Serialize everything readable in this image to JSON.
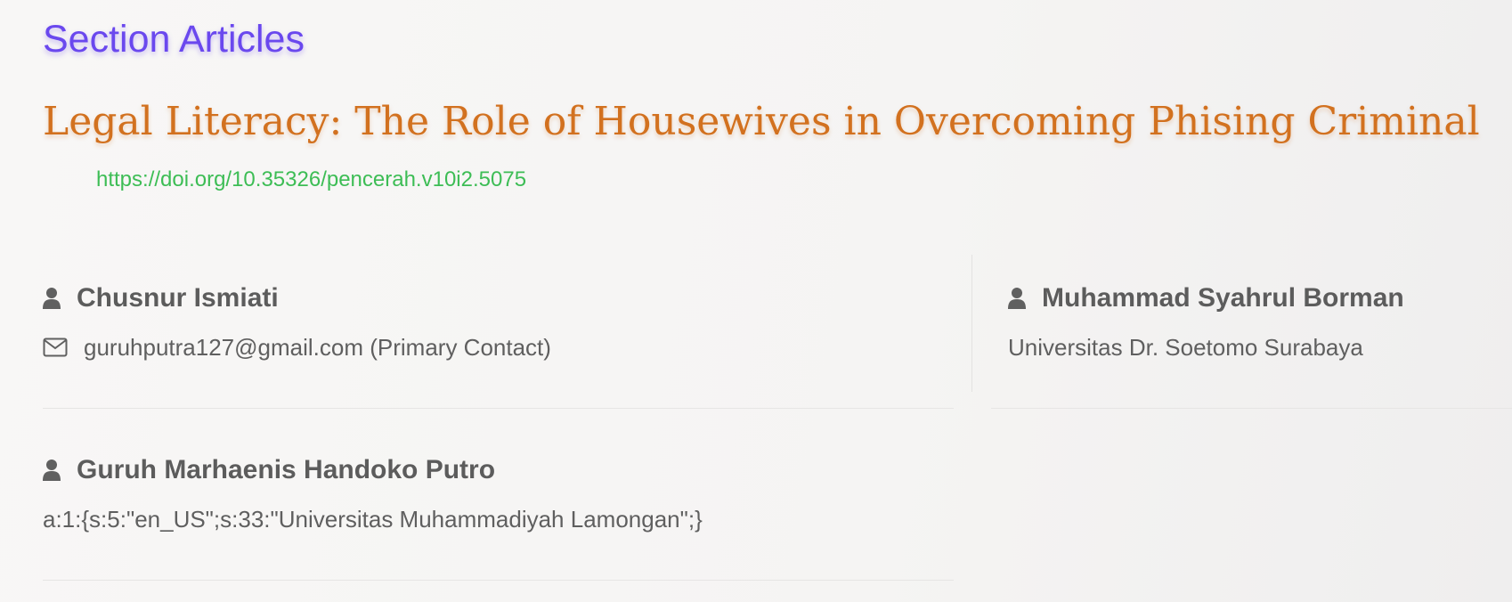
{
  "section": {
    "title": "Section Articles"
  },
  "article": {
    "title": "Legal Literacy: The Role of Housewives in Overcoming Phising Criminal",
    "doi": "https://doi.org/10.35326/pencerah.v10i2.5075"
  },
  "authors": [
    {
      "name": "Chusnur Ismiati",
      "detail": "guruhputra127@gmail.com (Primary Contact)",
      "detail_icon": "envelope-icon"
    },
    {
      "name": "Muhammad Syahrul Borman",
      "detail": "Universitas Dr. Soetomo Surabaya"
    },
    {
      "name": "Guruh Marhaenis Handoko Putro",
      "detail": "a:1:{s:5:\"en_US\";s:33:\"Universitas Muhammadiyah Lamongan\";}"
    }
  ],
  "icons": {
    "author": "user-icon",
    "email": "envelope-icon"
  },
  "colors": {
    "section_title": "#6a48ee",
    "article_title": "#d2711f",
    "doi_link": "#3dbd55",
    "text": "#5c5c5c"
  }
}
